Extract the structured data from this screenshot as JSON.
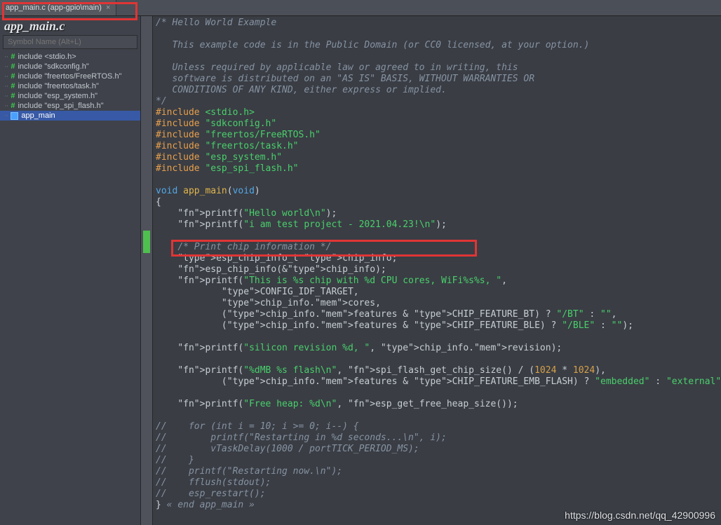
{
  "tab": {
    "title": "app_main.c (app-gpio\\main)",
    "close": "×"
  },
  "file_title": "app_main.c",
  "symbol_placeholder": "Symbol Name (Alt+L)",
  "symbols": [
    {
      "kind": "hash",
      "label": "include <stdio.h>"
    },
    {
      "kind": "hash",
      "label": "include \"sdkconfig.h\""
    },
    {
      "kind": "hash",
      "label": "include \"freertos/FreeRTOS.h\""
    },
    {
      "kind": "hash",
      "label": "include \"freertos/task.h\""
    },
    {
      "kind": "hash",
      "label": "include \"esp_system.h\""
    },
    {
      "kind": "hash",
      "label": "include \"esp_spi_flash.h\""
    },
    {
      "kind": "fn",
      "label": "app_main",
      "selected": true
    }
  ],
  "code": {
    "c_header": [
      "/* Hello World Example",
      "",
      "   This example code is in the Public Domain (or CC0 licensed, at your option.)",
      "",
      "   Unless required by applicable law or agreed to in writing, this",
      "   software is distributed on an \"AS IS\" BASIS, WITHOUT WARRANTIES OR",
      "   CONDITIONS OF ANY KIND, either express or implied.",
      "*/"
    ],
    "includes": [
      {
        "angle": true,
        "path": "stdio.h"
      },
      {
        "angle": false,
        "path": "sdkconfig.h"
      },
      {
        "angle": false,
        "path": "freertos/FreeRTOS.h"
      },
      {
        "angle": false,
        "path": "freertos/task.h"
      },
      {
        "angle": false,
        "path": "esp_system.h"
      },
      {
        "angle": false,
        "path": "esp_spi_flash.h"
      }
    ],
    "func_sig": {
      "ret": "void",
      "name": "app_main",
      "args": "void"
    },
    "hello_line": "printf(\"Hello world\\n\");",
    "test_line": "printf(\"i am test project - 2021.04.23!\\n\");",
    "chip_cmt": "/* Print chip information */",
    "chip_decl": "esp_chip_info_t chip_info;",
    "chip_call": "esp_chip_info(&chip_info);",
    "printf_hdr": "printf(\"This is %s chip with %d CPU cores, WiFi%s%s, \",",
    "printf_a1": "CONFIG_IDF_TARGET,",
    "printf_a2": "chip_info.cores,",
    "printf_bt": "(chip_info.features & CHIP_FEATURE_BT) ? \"/BT\" : \"\",",
    "printf_ble": "(chip_info.features & CHIP_FEATURE_BLE) ? \"/BLE\" : \"\");",
    "printf_rev": "printf(\"silicon revision %d, \", chip_info.revision);",
    "printf_flash": "printf(\"%dMB %s flash\\n\", spi_flash_get_chip_size() / (1024 * 1024),",
    "printf_emb": "(chip_info.features & CHIP_FEATURE_EMB_FLASH) ? \"embedded\" : \"external\");",
    "printf_heap": "printf(\"Free heap: %d\\n\", esp_get_free_heap_size());",
    "tail_comment": [
      "//    for (int i = 10; i >= 0; i--) {",
      "//        printf(\"Restarting in %d seconds...\\n\", i);",
      "//        vTaskDelay(1000 / portTICK_PERIOD_MS);",
      "//    }",
      "//    printf(\"Restarting now.\\n\");",
      "//    fflush(stdout);",
      "//    esp_restart();"
    ],
    "end_brace": "} « end app_main »"
  },
  "watermark": "https://blog.csdn.net/qq_42900996"
}
